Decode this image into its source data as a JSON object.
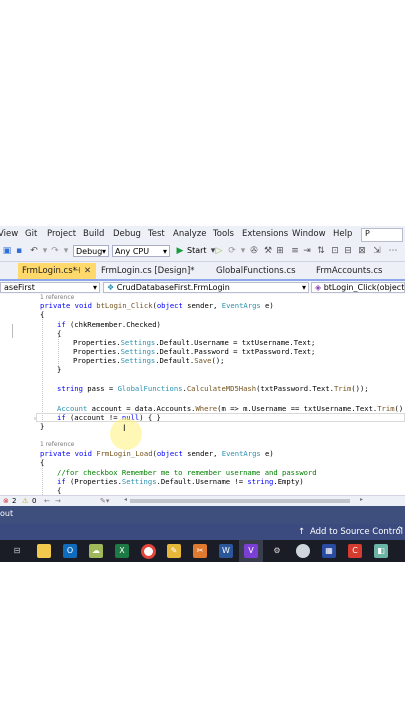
{
  "menu": {
    "items": [
      "View",
      "Git",
      "Project",
      "Build",
      "Debug",
      "Test",
      "Analyze",
      "Tools",
      "Extensions",
      "Window",
      "Help"
    ],
    "search_label": "P"
  },
  "toolbar": {
    "config": "Debug",
    "platform": "Any CPU",
    "start_label": "Start"
  },
  "tabs": [
    {
      "label": "FrmLogin.cs*",
      "active": true
    },
    {
      "label": "FrmLogin.cs [Design]*",
      "active": false
    },
    {
      "label": "GlobalFunctions.cs",
      "active": false
    },
    {
      "label": "FrmAccounts.cs",
      "active": false
    }
  ],
  "nav": {
    "project": "aseFirst",
    "class": "CrudDatabaseFirst.FrmLogin",
    "member": "btLogin_Click(object se"
  },
  "code": {
    "ref1": "1 reference",
    "ref2": "1 reference",
    "line_1": {
      "kw1": "private",
      "kw2": "void",
      "name": "btLogin_Click",
      "p1": "object",
      "a1": " sender, ",
      "p2": "EventArgs",
      "a2": " e)"
    },
    "line_2": "{",
    "line_3": {
      "kw": "if",
      "rest": " (chkRemember.Checked)"
    },
    "line_4": "{",
    "line_5": {
      "a": "Properties.",
      "b": "Settings",
      "c": ".Default.Username = txtUsername.Text;"
    },
    "line_6": {
      "a": "Properties.",
      "b": "Settings",
      "c": ".Default.Password = txtPassword.Text;"
    },
    "line_7": {
      "a": "Properties.",
      "b": "Settings",
      "c": ".Default.",
      "d": "Save",
      "e": "();"
    },
    "line_8": "}",
    "line_9": {
      "kw": "string",
      "a": " pass = ",
      "b": "GlobalFunctions",
      "c": ".",
      "d": "CalculateMD5Hash",
      "e": "(txtPassword.Text.",
      "f": "Trim",
      "g": "());"
    },
    "line_10": {
      "a": "Account",
      "b": " account = data.Accounts.",
      "c": "Where",
      "d": "(m => m.Username == txtUsername.Text.",
      "e": "Trim",
      "f": "() &&"
    },
    "line_11": {
      "kw": "if",
      "a": " (account != ",
      "b": "null",
      "c": ") { }"
    },
    "line_12": "}",
    "line_13": {
      "kw1": "private",
      "kw2": "void",
      "name": "FrmLogin_Load",
      "p1": "object",
      "a1": " sender, ",
      "p2": "EventArgs",
      "a2": " e)"
    },
    "line_14": "{",
    "line_15": "//for checkbox Remember me to remember username and password",
    "line_16": {
      "kw": "if",
      "a": " (Properties.",
      "b": "Settings",
      "c": ".Default.Username != ",
      "d": "string",
      "e": ".Empty)"
    },
    "line_17": "{"
  },
  "editor_status": {
    "errors": "2",
    "warnings": "0"
  },
  "output_label": "out",
  "statusbar": {
    "source_control": "Add to Source Control"
  },
  "colors": {
    "active_tab": "#ffd96b",
    "statusbar": "#3c4b7f",
    "keyword": "#0000ff",
    "type": "#2b91af",
    "comment": "#008000"
  }
}
